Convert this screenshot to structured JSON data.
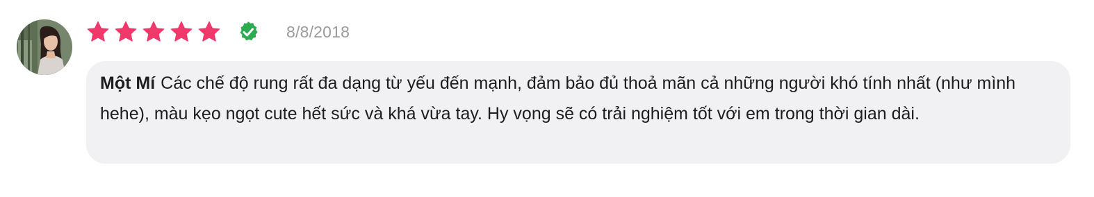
{
  "review": {
    "rating": 5,
    "rating_max": 5,
    "date": "8/8/2018",
    "author": "Một Mí",
    "text": "Các chế độ rung rất đa dạng từ yếu đến mạnh, đảm bảo đủ thoả mãn cả những người khó tính nhất (như mình hehe), màu kẹo ngọt cute hết sức và khá vừa tay. Hy vọng sẽ có trải nghiệm tốt với em trong thời gian dài."
  },
  "icons": {
    "star": "star-icon",
    "verified": "verified-check-icon",
    "avatar": "user-avatar"
  },
  "colors": {
    "star": "#f0386b",
    "verified": "#2eaa4f",
    "date": "#9a9a9a",
    "bubble_bg": "#f1f1f4",
    "text": "#1d1d1d"
  }
}
